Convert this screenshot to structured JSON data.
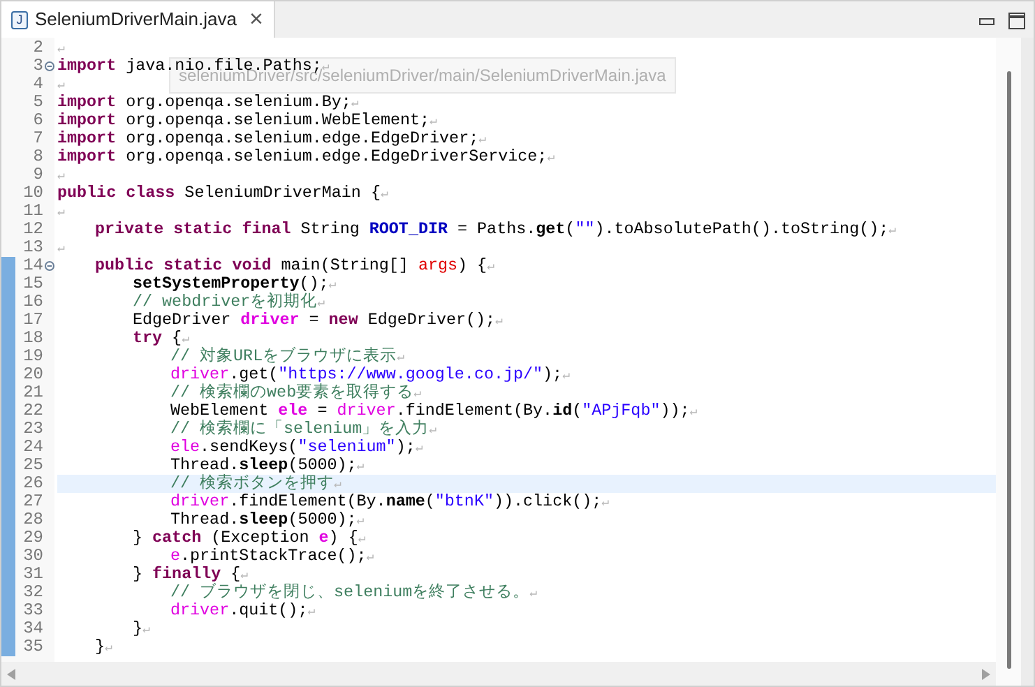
{
  "tab": {
    "title": "SeleniumDriverMain.java",
    "icon_letter": "J",
    "close": "×",
    "selected": true
  },
  "hover_path": "seleniumDriver/src/seleniumDriver/main/SeleniumDriverMain.java",
  "lines": [
    {
      "number": "2",
      "kind": "top",
      "changed": false,
      "fold": false,
      "highlighted": false,
      "tokens": [
        {
          "text": "↵",
          "kind": "eol"
        }
      ]
    },
    {
      "number": "3",
      "kind": "top",
      "changed": false,
      "fold": true,
      "highlighted": false,
      "tokens": [
        {
          "text": "import",
          "kind": "keyword"
        },
        {
          "text": " java.nio.file.Paths;",
          "kind": "plain"
        },
        {
          "text": "↵",
          "kind": "eol"
        }
      ]
    },
    {
      "number": "4",
      "kind": "top",
      "changed": false,
      "fold": false,
      "highlighted": false,
      "tokens": [
        {
          "text": "↵",
          "kind": "eol"
        }
      ]
    },
    {
      "number": "5",
      "kind": "top",
      "changed": false,
      "fold": false,
      "highlighted": false,
      "tokens": [
        {
          "text": "import",
          "kind": "keyword"
        },
        {
          "text": " org.openqa.selenium.By;",
          "kind": "plain"
        },
        {
          "text": "↵",
          "kind": "eol"
        }
      ]
    },
    {
      "number": "6",
      "kind": "top",
      "changed": false,
      "fold": false,
      "highlighted": false,
      "tokens": [
        {
          "text": "import",
          "kind": "keyword"
        },
        {
          "text": " org.openqa.selenium.WebElement;",
          "kind": "plain"
        },
        {
          "text": "↵",
          "kind": "eol"
        }
      ]
    },
    {
      "number": "7",
      "kind": "top",
      "changed": false,
      "fold": false,
      "highlighted": false,
      "tokens": [
        {
          "text": "import",
          "kind": "keyword"
        },
        {
          "text": " org.openqa.selenium.edge.EdgeDriver;",
          "kind": "plain"
        },
        {
          "text": "↵",
          "kind": "eol"
        }
      ]
    },
    {
      "number": "8",
      "kind": "top",
      "changed": false,
      "fold": false,
      "highlighted": false,
      "tokens": [
        {
          "text": "import",
          "kind": "keyword"
        },
        {
          "text": " org.openqa.selenium.edge.EdgeDriverService;",
          "kind": "plain"
        },
        {
          "text": "↵",
          "kind": "eol"
        }
      ]
    },
    {
      "number": "9",
      "kind": "top",
      "changed": false,
      "fold": false,
      "highlighted": false,
      "tokens": [
        {
          "text": "↵",
          "kind": "eol"
        }
      ]
    },
    {
      "number": "10",
      "kind": "top",
      "changed": false,
      "fold": false,
      "highlighted": false,
      "tokens": [
        {
          "text": "public class",
          "kind": "keyword"
        },
        {
          "text": " SeleniumDriverMain {",
          "kind": "plain"
        },
        {
          "text": "↵",
          "kind": "eol"
        }
      ]
    },
    {
      "number": "11",
      "kind": "top",
      "changed": false,
      "fold": false,
      "highlighted": false,
      "tokens": [
        {
          "text": "↵",
          "kind": "eol"
        }
      ]
    },
    {
      "number": "12",
      "kind": "member",
      "changed": false,
      "fold": false,
      "highlighted": false,
      "tokens": [
        {
          "text": "private static final",
          "kind": "keyword"
        },
        {
          "text": " String ",
          "kind": "plain"
        },
        {
          "text": "ROOT_DIR",
          "kind": "field"
        },
        {
          "text": " = Paths.",
          "kind": "plain"
        },
        {
          "text": "get",
          "kind": "static-method"
        },
        {
          "text": "(",
          "kind": "plain"
        },
        {
          "text": "\"\"",
          "kind": "string"
        },
        {
          "text": ").toAbsolutePath().toString();",
          "kind": "plain"
        },
        {
          "text": "↵",
          "kind": "eol"
        }
      ]
    },
    {
      "number": "13",
      "kind": "top",
      "changed": false,
      "fold": false,
      "highlighted": false,
      "tokens": [
        {
          "text": "↵",
          "kind": "eol"
        }
      ]
    },
    {
      "number": "14",
      "kind": "member",
      "changed": true,
      "fold": true,
      "highlighted": false,
      "tokens": [
        {
          "text": "public static void",
          "kind": "keyword"
        },
        {
          "text": " main(String[] ",
          "kind": "plain"
        },
        {
          "text": "args",
          "kind": "param"
        },
        {
          "text": ") {",
          "kind": "plain"
        },
        {
          "text": "↵",
          "kind": "eol"
        }
      ]
    },
    {
      "number": "15",
      "kind": "body",
      "changed": true,
      "fold": false,
      "highlighted": false,
      "tokens": [
        {
          "text": "setSystemProperty",
          "kind": "static-method"
        },
        {
          "text": "();",
          "kind": "plain"
        },
        {
          "text": "↵",
          "kind": "eol"
        }
      ]
    },
    {
      "number": "16",
      "kind": "body",
      "changed": true,
      "fold": false,
      "highlighted": false,
      "tokens": [
        {
          "text": "// webdriverを初期化",
          "kind": "comment"
        },
        {
          "text": "↵",
          "kind": "eol"
        }
      ]
    },
    {
      "number": "17",
      "kind": "body",
      "changed": true,
      "fold": false,
      "highlighted": false,
      "tokens": [
        {
          "text": "EdgeDriver ",
          "kind": "plain"
        },
        {
          "text": "driver",
          "kind": "local-decl"
        },
        {
          "text": " = ",
          "kind": "plain"
        },
        {
          "text": "new",
          "kind": "keyword"
        },
        {
          "text": " EdgeDriver();",
          "kind": "plain"
        },
        {
          "text": "↵",
          "kind": "eol"
        }
      ]
    },
    {
      "number": "18",
      "kind": "body",
      "changed": true,
      "fold": false,
      "highlighted": false,
      "tokens": [
        {
          "text": "try",
          "kind": "keyword"
        },
        {
          "text": " {",
          "kind": "plain"
        },
        {
          "text": "↵",
          "kind": "eol"
        }
      ]
    },
    {
      "number": "19",
      "kind": "inner",
      "changed": true,
      "fold": false,
      "highlighted": false,
      "tokens": [
        {
          "text": "// 対象URLをブラウザに表示",
          "kind": "comment"
        },
        {
          "text": "↵",
          "kind": "eol"
        }
      ]
    },
    {
      "number": "20",
      "kind": "inner",
      "changed": true,
      "fold": false,
      "highlighted": false,
      "tokens": [
        {
          "text": "driver",
          "kind": "local"
        },
        {
          "text": ".get(",
          "kind": "plain"
        },
        {
          "text": "\"https://www.google.co.jp/\"",
          "kind": "string"
        },
        {
          "text": ");",
          "kind": "plain"
        },
        {
          "text": "↵",
          "kind": "eol"
        }
      ]
    },
    {
      "number": "21",
      "kind": "inner",
      "changed": true,
      "fold": false,
      "highlighted": false,
      "tokens": [
        {
          "text": "// 検索欄のweb要素を取得する",
          "kind": "comment"
        },
        {
          "text": "↵",
          "kind": "eol"
        }
      ]
    },
    {
      "number": "22",
      "kind": "inner",
      "changed": true,
      "fold": false,
      "highlighted": false,
      "tokens": [
        {
          "text": "WebElement ",
          "kind": "plain"
        },
        {
          "text": "ele",
          "kind": "local-decl"
        },
        {
          "text": " = ",
          "kind": "plain"
        },
        {
          "text": "driver",
          "kind": "local"
        },
        {
          "text": ".findElement(By.",
          "kind": "plain"
        },
        {
          "text": "id",
          "kind": "static-method"
        },
        {
          "text": "(",
          "kind": "plain"
        },
        {
          "text": "\"APjFqb\"",
          "kind": "string"
        },
        {
          "text": "));",
          "kind": "plain"
        },
        {
          "text": "↵",
          "kind": "eol"
        }
      ]
    },
    {
      "number": "23",
      "kind": "inner",
      "changed": true,
      "fold": false,
      "highlighted": false,
      "tokens": [
        {
          "text": "// 検索欄に「selenium」を入力",
          "kind": "comment"
        },
        {
          "text": "↵",
          "kind": "eol"
        }
      ]
    },
    {
      "number": "24",
      "kind": "inner",
      "changed": true,
      "fold": false,
      "highlighted": false,
      "tokens": [
        {
          "text": "ele",
          "kind": "local"
        },
        {
          "text": ".sendKeys(",
          "kind": "plain"
        },
        {
          "text": "\"selenium\"",
          "kind": "string"
        },
        {
          "text": ");",
          "kind": "plain"
        },
        {
          "text": "↵",
          "kind": "eol"
        }
      ]
    },
    {
      "number": "25",
      "kind": "inner",
      "changed": true,
      "fold": false,
      "highlighted": false,
      "tokens": [
        {
          "text": "Thread.",
          "kind": "plain"
        },
        {
          "text": "sleep",
          "kind": "static-method"
        },
        {
          "text": "(5000);",
          "kind": "plain"
        },
        {
          "text": "↵",
          "kind": "eol"
        }
      ]
    },
    {
      "number": "26",
      "kind": "inner",
      "changed": true,
      "fold": false,
      "highlighted": true,
      "tokens": [
        {
          "text": "// 検索ボタンを押す",
          "kind": "comment"
        },
        {
          "text": "↵",
          "kind": "eol"
        }
      ]
    },
    {
      "number": "27",
      "kind": "inner",
      "changed": true,
      "fold": false,
      "highlighted": false,
      "tokens": [
        {
          "text": "driver",
          "kind": "local"
        },
        {
          "text": ".findElement(By.",
          "kind": "plain"
        },
        {
          "text": "name",
          "kind": "static-method"
        },
        {
          "text": "(",
          "kind": "plain"
        },
        {
          "text": "\"btnK\"",
          "kind": "string"
        },
        {
          "text": ")).click();",
          "kind": "plain"
        },
        {
          "text": "↵",
          "kind": "eol"
        }
      ]
    },
    {
      "number": "28",
      "kind": "inner",
      "changed": true,
      "fold": false,
      "highlighted": false,
      "tokens": [
        {
          "text": "Thread.",
          "kind": "plain"
        },
        {
          "text": "sleep",
          "kind": "static-method"
        },
        {
          "text": "(5000);",
          "kind": "plain"
        },
        {
          "text": "↵",
          "kind": "eol"
        }
      ]
    },
    {
      "number": "29",
      "kind": "body",
      "changed": true,
      "fold": false,
      "highlighted": false,
      "tokens": [
        {
          "text": "} ",
          "kind": "plain"
        },
        {
          "text": "catch",
          "kind": "keyword"
        },
        {
          "text": " (Exception ",
          "kind": "plain"
        },
        {
          "text": "e",
          "kind": "local-decl"
        },
        {
          "text": ") {",
          "kind": "plain"
        },
        {
          "text": "↵",
          "kind": "eol"
        }
      ]
    },
    {
      "number": "30",
      "kind": "inner",
      "changed": true,
      "fold": false,
      "highlighted": false,
      "tokens": [
        {
          "text": "e",
          "kind": "local"
        },
        {
          "text": ".printStackTrace();",
          "kind": "plain"
        },
        {
          "text": "↵",
          "kind": "eol"
        }
      ]
    },
    {
      "number": "31",
      "kind": "body",
      "changed": true,
      "fold": false,
      "highlighted": false,
      "tokens": [
        {
          "text": "} ",
          "kind": "plain"
        },
        {
          "text": "finally",
          "kind": "keyword"
        },
        {
          "text": " {",
          "kind": "plain"
        },
        {
          "text": "↵",
          "kind": "eol"
        }
      ]
    },
    {
      "number": "32",
      "kind": "inner",
      "changed": true,
      "fold": false,
      "highlighted": false,
      "tokens": [
        {
          "text": "// ブラウザを閉じ、seleniumを終了させる。",
          "kind": "comment"
        },
        {
          "text": "↵",
          "kind": "eol"
        }
      ]
    },
    {
      "number": "33",
      "kind": "inner",
      "changed": true,
      "fold": false,
      "highlighted": false,
      "tokens": [
        {
          "text": "driver",
          "kind": "local"
        },
        {
          "text": ".quit();",
          "kind": "plain"
        },
        {
          "text": "↵",
          "kind": "eol"
        }
      ]
    },
    {
      "number": "34",
      "kind": "body",
      "changed": true,
      "fold": false,
      "highlighted": false,
      "tokens": [
        {
          "text": "}",
          "kind": "plain"
        },
        {
          "text": "↵",
          "kind": "eol"
        }
      ]
    },
    {
      "number": "35",
      "kind": "member",
      "changed": true,
      "fold": false,
      "highlighted": false,
      "tokens": [
        {
          "text": "}",
          "kind": "plain"
        },
        {
          "text": "↵",
          "kind": "eol"
        }
      ]
    }
  ]
}
